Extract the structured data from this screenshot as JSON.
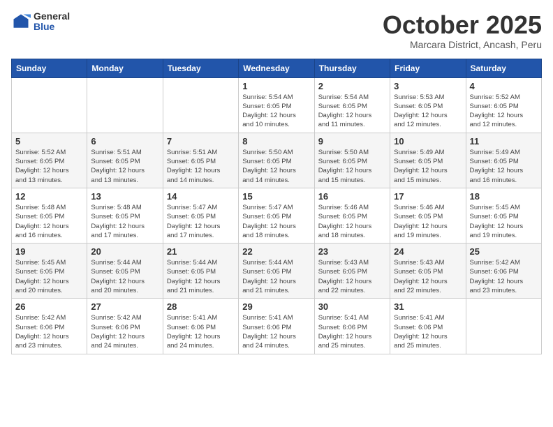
{
  "header": {
    "logo_general": "General",
    "logo_blue": "Blue",
    "month_title": "October 2025",
    "subtitle": "Marcara District, Ancash, Peru"
  },
  "weekdays": [
    "Sunday",
    "Monday",
    "Tuesday",
    "Wednesday",
    "Thursday",
    "Friday",
    "Saturday"
  ],
  "weeks": [
    [
      {
        "day": "",
        "info": ""
      },
      {
        "day": "",
        "info": ""
      },
      {
        "day": "",
        "info": ""
      },
      {
        "day": "1",
        "info": "Sunrise: 5:54 AM\nSunset: 6:05 PM\nDaylight: 12 hours\nand 10 minutes."
      },
      {
        "day": "2",
        "info": "Sunrise: 5:54 AM\nSunset: 6:05 PM\nDaylight: 12 hours\nand 11 minutes."
      },
      {
        "day": "3",
        "info": "Sunrise: 5:53 AM\nSunset: 6:05 PM\nDaylight: 12 hours\nand 12 minutes."
      },
      {
        "day": "4",
        "info": "Sunrise: 5:52 AM\nSunset: 6:05 PM\nDaylight: 12 hours\nand 12 minutes."
      }
    ],
    [
      {
        "day": "5",
        "info": "Sunrise: 5:52 AM\nSunset: 6:05 PM\nDaylight: 12 hours\nand 13 minutes."
      },
      {
        "day": "6",
        "info": "Sunrise: 5:51 AM\nSunset: 6:05 PM\nDaylight: 12 hours\nand 13 minutes."
      },
      {
        "day": "7",
        "info": "Sunrise: 5:51 AM\nSunset: 6:05 PM\nDaylight: 12 hours\nand 14 minutes."
      },
      {
        "day": "8",
        "info": "Sunrise: 5:50 AM\nSunset: 6:05 PM\nDaylight: 12 hours\nand 14 minutes."
      },
      {
        "day": "9",
        "info": "Sunrise: 5:50 AM\nSunset: 6:05 PM\nDaylight: 12 hours\nand 15 minutes."
      },
      {
        "day": "10",
        "info": "Sunrise: 5:49 AM\nSunset: 6:05 PM\nDaylight: 12 hours\nand 15 minutes."
      },
      {
        "day": "11",
        "info": "Sunrise: 5:49 AM\nSunset: 6:05 PM\nDaylight: 12 hours\nand 16 minutes."
      }
    ],
    [
      {
        "day": "12",
        "info": "Sunrise: 5:48 AM\nSunset: 6:05 PM\nDaylight: 12 hours\nand 16 minutes."
      },
      {
        "day": "13",
        "info": "Sunrise: 5:48 AM\nSunset: 6:05 PM\nDaylight: 12 hours\nand 17 minutes."
      },
      {
        "day": "14",
        "info": "Sunrise: 5:47 AM\nSunset: 6:05 PM\nDaylight: 12 hours\nand 17 minutes."
      },
      {
        "day": "15",
        "info": "Sunrise: 5:47 AM\nSunset: 6:05 PM\nDaylight: 12 hours\nand 18 minutes."
      },
      {
        "day": "16",
        "info": "Sunrise: 5:46 AM\nSunset: 6:05 PM\nDaylight: 12 hours\nand 18 minutes."
      },
      {
        "day": "17",
        "info": "Sunrise: 5:46 AM\nSunset: 6:05 PM\nDaylight: 12 hours\nand 19 minutes."
      },
      {
        "day": "18",
        "info": "Sunrise: 5:45 AM\nSunset: 6:05 PM\nDaylight: 12 hours\nand 19 minutes."
      }
    ],
    [
      {
        "day": "19",
        "info": "Sunrise: 5:45 AM\nSunset: 6:05 PM\nDaylight: 12 hours\nand 20 minutes."
      },
      {
        "day": "20",
        "info": "Sunrise: 5:44 AM\nSunset: 6:05 PM\nDaylight: 12 hours\nand 20 minutes."
      },
      {
        "day": "21",
        "info": "Sunrise: 5:44 AM\nSunset: 6:05 PM\nDaylight: 12 hours\nand 21 minutes."
      },
      {
        "day": "22",
        "info": "Sunrise: 5:44 AM\nSunset: 6:05 PM\nDaylight: 12 hours\nand 21 minutes."
      },
      {
        "day": "23",
        "info": "Sunrise: 5:43 AM\nSunset: 6:05 PM\nDaylight: 12 hours\nand 22 minutes."
      },
      {
        "day": "24",
        "info": "Sunrise: 5:43 AM\nSunset: 6:05 PM\nDaylight: 12 hours\nand 22 minutes."
      },
      {
        "day": "25",
        "info": "Sunrise: 5:42 AM\nSunset: 6:06 PM\nDaylight: 12 hours\nand 23 minutes."
      }
    ],
    [
      {
        "day": "26",
        "info": "Sunrise: 5:42 AM\nSunset: 6:06 PM\nDaylight: 12 hours\nand 23 minutes."
      },
      {
        "day": "27",
        "info": "Sunrise: 5:42 AM\nSunset: 6:06 PM\nDaylight: 12 hours\nand 24 minutes."
      },
      {
        "day": "28",
        "info": "Sunrise: 5:41 AM\nSunset: 6:06 PM\nDaylight: 12 hours\nand 24 minutes."
      },
      {
        "day": "29",
        "info": "Sunrise: 5:41 AM\nSunset: 6:06 PM\nDaylight: 12 hours\nand 24 minutes."
      },
      {
        "day": "30",
        "info": "Sunrise: 5:41 AM\nSunset: 6:06 PM\nDaylight: 12 hours\nand 25 minutes."
      },
      {
        "day": "31",
        "info": "Sunrise: 5:41 AM\nSunset: 6:06 PM\nDaylight: 12 hours\nand 25 minutes."
      },
      {
        "day": "",
        "info": ""
      }
    ]
  ]
}
